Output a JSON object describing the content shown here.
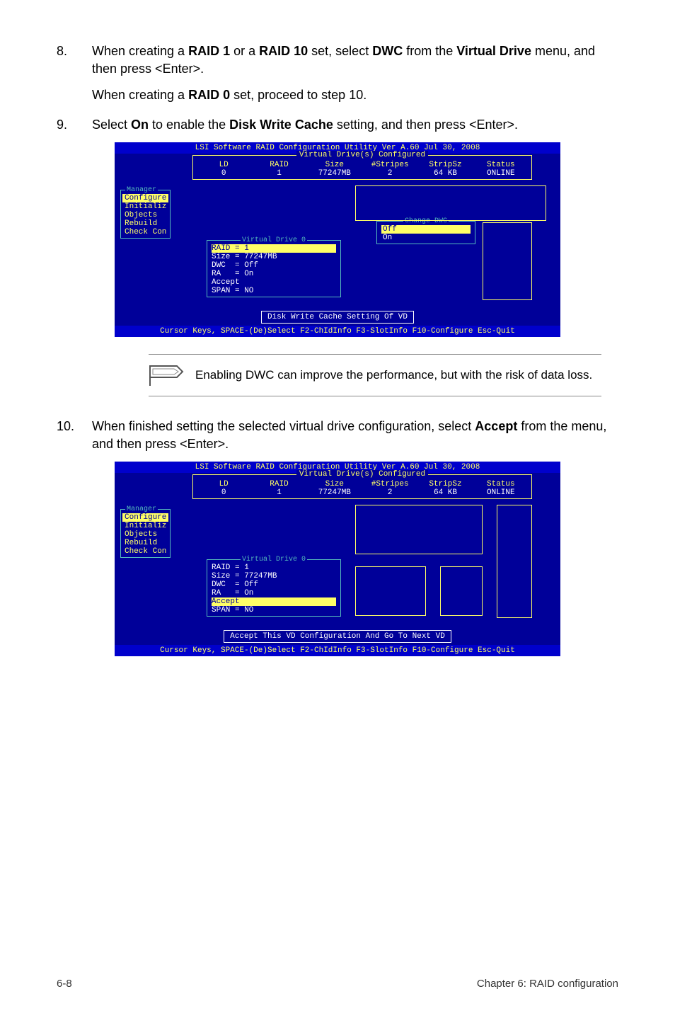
{
  "steps": {
    "s8_num": "8.",
    "s8_p1": "When creating a ",
    "s8_b1": "RAID 1",
    "s8_p2": " or a ",
    "s8_b2": "RAID 10",
    "s8_p3": " set, select ",
    "s8_b3": "DWC",
    "s8_p4": " from the ",
    "s8_b4": "Virtual Drive",
    "s8_p5": " menu, and then press <Enter>.",
    "s8_sub_a": "When creating a ",
    "s8_sub_b": "RAID 0",
    "s8_sub_c": " set, proceed to step 10.",
    "s9_num": "9.",
    "s9_p1": "Select ",
    "s9_b1": "On",
    "s9_p2": " to enable the ",
    "s9_b2": "Disk Write Cache",
    "s9_p3": " setting, and then press <Enter>.",
    "s10_num": "10.",
    "s10_p1": "When finished setting the selected virtual drive configuration, select ",
    "s10_b1": "Accept",
    "s10_p2": " from the menu, and then press <Enter>."
  },
  "term_common": {
    "title": "LSI Software RAID Configuration Utility Ver A.60 Jul 30, 2008",
    "header_box": "Virtual Drive(s) Configured",
    "cols": [
      {
        "h": "LD",
        "v": "0"
      },
      {
        "h": "RAID",
        "v": "1"
      },
      {
        "h": "Size",
        "v": "77247MB"
      },
      {
        "h": "#Stripes",
        "v": "2"
      },
      {
        "h": "StripSz",
        "v": "64 KB"
      },
      {
        "h": "Status",
        "v": "ONLINE"
      }
    ],
    "sidebar_label": "Manager",
    "sidebar_items": [
      "Configure",
      "Initializ",
      "Objects",
      "Rebuild",
      "Check Con"
    ],
    "vd_label": "Virtual Drive 0",
    "vd_lines": [
      "RAID = 1",
      "Size = 77247MB",
      "DWC  = Off",
      "RA   = On",
      "Accept",
      "SPAN = NO"
    ],
    "footer": "Cursor Keys, SPACE-(De)Select F2-ChIdInfo F3-SlotInfo F10-Configure Esc-Quit"
  },
  "term1": {
    "dwc_label": "Change DWC",
    "dwc_lines": [
      "Off",
      "On"
    ],
    "highlight_sidebar_index": 0,
    "highlight_vd_index": 0,
    "highlight_dwc_index": 0,
    "msg": "Disk Write Cache Setting Of VD"
  },
  "term2": {
    "highlight_sidebar_index": 0,
    "highlight_vd_index": 4,
    "msg": "Accept This VD Configuration And Go To Next VD"
  },
  "note": "Enabling DWC can improve the performance, but with the risk of data loss.",
  "footer": {
    "left": "6-8",
    "right": "Chapter 6: RAID configuration"
  }
}
